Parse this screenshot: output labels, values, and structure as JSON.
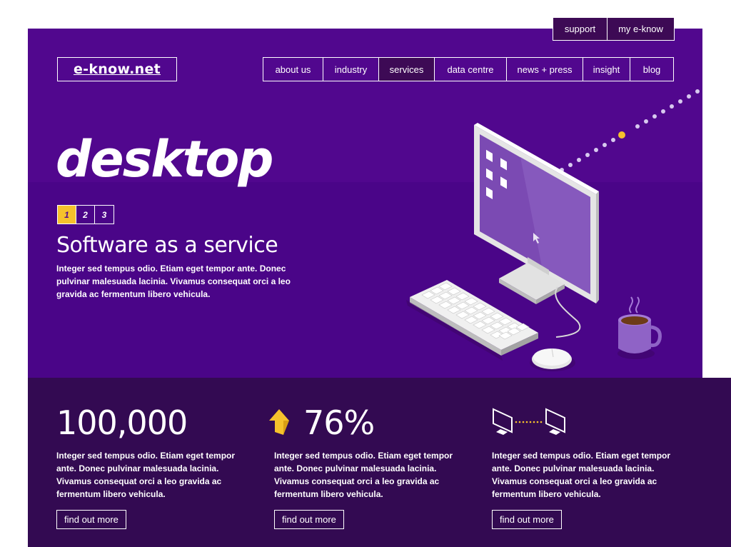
{
  "utility_nav": {
    "support": "support",
    "my_eknow": "my e-know"
  },
  "logo": "e-know.net",
  "main_nav": {
    "items": [
      {
        "label": "about us"
      },
      {
        "label": "industry"
      },
      {
        "label": "services",
        "active": true
      },
      {
        "label": "data centre"
      },
      {
        "label": "news + press"
      },
      {
        "label": "insight"
      },
      {
        "label": "blog"
      }
    ]
  },
  "hero": {
    "title": "desktop",
    "pager": [
      "1",
      "2",
      "3"
    ],
    "active_page": "1",
    "subtitle": "Software as a service",
    "body": "Integer sed tempus odio. Etiam eget tempor ante. Donec pulvinar malesuada lacinia. Vivamus consequat orci a leo gravida ac fermentum libero vehicula."
  },
  "stats": [
    {
      "value": "100,000",
      "text": "Integer sed tempus odio. Etiam eget tempor ante. Donec pulvinar malesuada lacinia. Vivamus consequat orci a leo gravida ac fermentum libero vehicula.",
      "button": "find out more"
    },
    {
      "value": "76%",
      "icon": "arrow-up-icon",
      "text": "Integer sed tempus odio. Etiam eget tempor ante. Donec pulvinar malesuada lacinia. Vivamus consequat orci a leo gravida ac fermentum libero vehicula.",
      "button": "find out more"
    },
    {
      "icon": "monitors-sync-icon",
      "text": "Integer sed tempus odio. Etiam eget tempor ante. Donec pulvinar malesuada lacinia. Vivamus consequat orci a leo gravida ac fermentum libero vehicula.",
      "button": "find out more"
    }
  ],
  "colors": {
    "hero_bg": "#51078e",
    "stats_bg": "#330a52",
    "accent": "#f6c12c",
    "nav_active": "#3d0a55"
  }
}
